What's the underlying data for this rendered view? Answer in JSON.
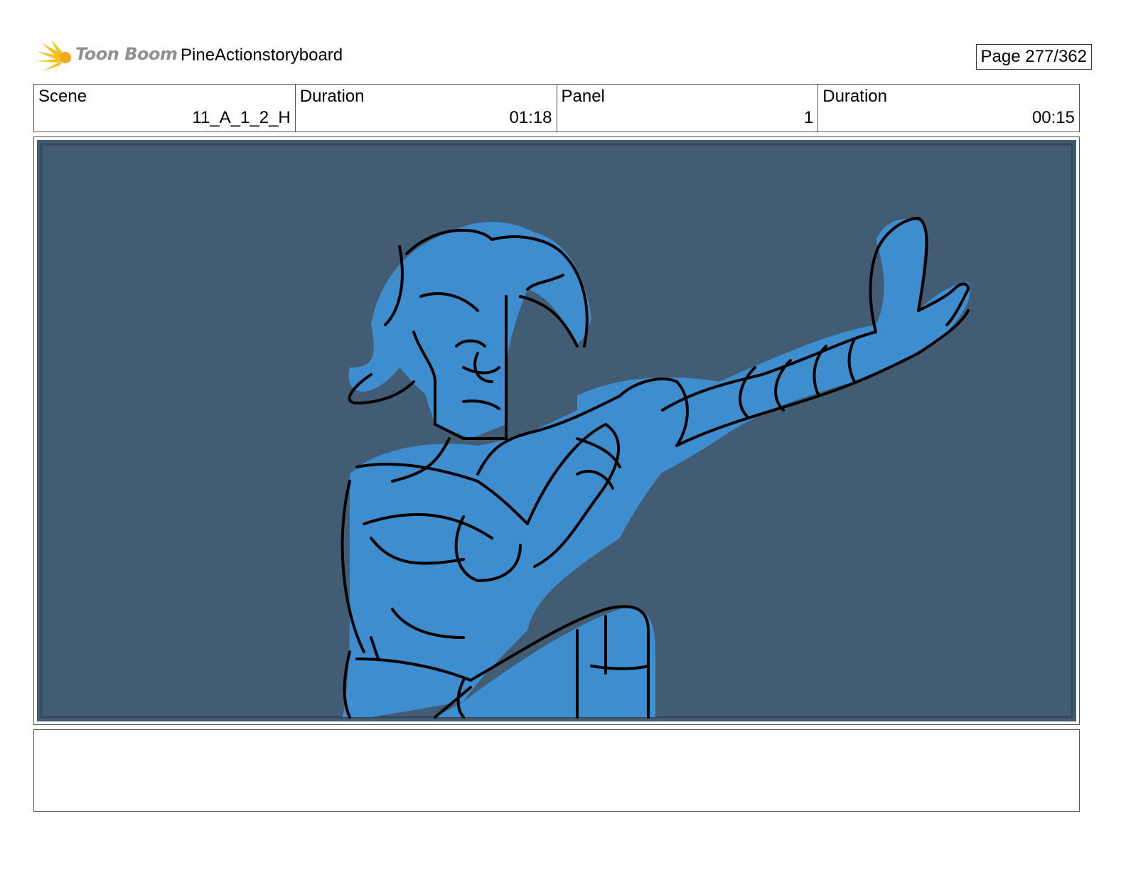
{
  "header": {
    "logo_text": "Toon Boom",
    "project_title": "PineActionstoryboard",
    "page_label": "Page 277/362"
  },
  "info": [
    {
      "label": "Scene",
      "value": "11_A_1_2_H"
    },
    {
      "label": "Duration",
      "value": "01:18"
    },
    {
      "label": "Panel",
      "value": "1"
    },
    {
      "label": "Duration",
      "value": "00:15"
    }
  ],
  "panel": {
    "background_color": "#425d73",
    "figure_color": "#3e8ecf",
    "line_color": "#000000"
  },
  "notes": {
    "text": ""
  }
}
